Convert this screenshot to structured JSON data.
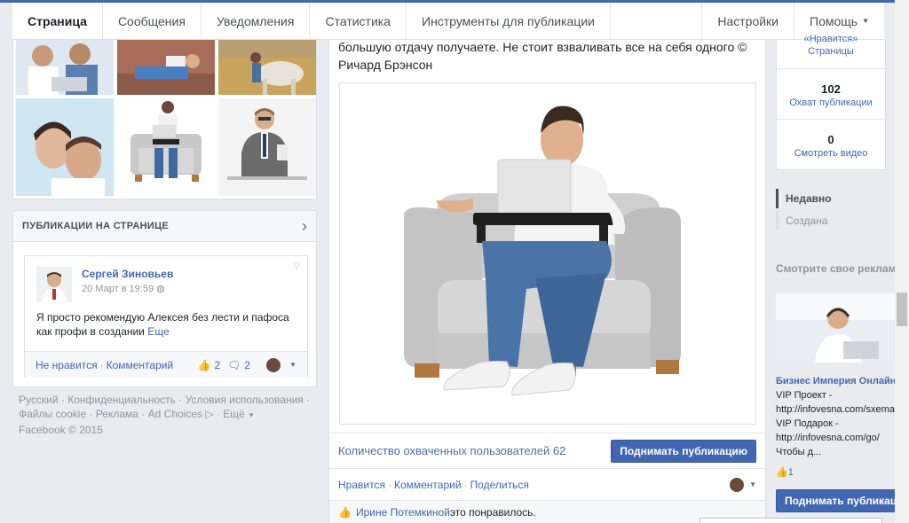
{
  "nav": {
    "tabs": [
      "Страница",
      "Сообщения",
      "Уведомления",
      "Статистика",
      "Инструменты для публикации"
    ],
    "settings": "Настройки",
    "help": "Помощь"
  },
  "pubs": {
    "title": "ПУБЛИКАЦИИ НА СТРАНИЦЕ",
    "post": {
      "author": "Сергей Зиновьев",
      "time": "20 Март в 19:59",
      "text": "Я просто рекомендую Алексея без лести и пафоса как профи в создании ",
      "more": "Еще",
      "unlike": "Не нравится",
      "comment": "Комментарий",
      "likes": "2",
      "comments": "2"
    }
  },
  "footer": {
    "links": [
      "Русский",
      "Конфиденциальность",
      "Условия использования",
      "Файлы cookie",
      "Реклама",
      "Ad Choices",
      "Ещё"
    ],
    "copyright": "Facebook © 2015"
  },
  "center": {
    "quote": "большую отдачу получаете. Не стоит взваливать все на себя одного © Ричард Брэнсон",
    "reach": "Количество охваченных пользователей 62",
    "boost": "Поднимать публикацию",
    "like": "Нравится",
    "comment": "Комментарий",
    "share": "Поделиться",
    "liked_by": "Ирине Потемкиной",
    "liked_suffix": " это понравилось."
  },
  "stats": {
    "likes_label": "«Нравится» Страницы",
    "reach_value": "102",
    "reach_label": "Охват публикации",
    "video_value": "0",
    "video_label": "Смотреть видео"
  },
  "filters": {
    "recent": "Недавно",
    "created": "Создана"
  },
  "ad": {
    "section_title": "Смотрите свое реклам",
    "name": "Бизнес Империя Онлайн",
    "text": "VIP Проект -\nhttp://infovesna.com/sxema\nVIP Подарок -\nhttp://infovesna.com/go/\nЧтобы д...",
    "likes": "1",
    "boost": "Поднимать публикацию"
  },
  "colors": {
    "brand": "#4267b2",
    "background": "#e9ebee"
  }
}
